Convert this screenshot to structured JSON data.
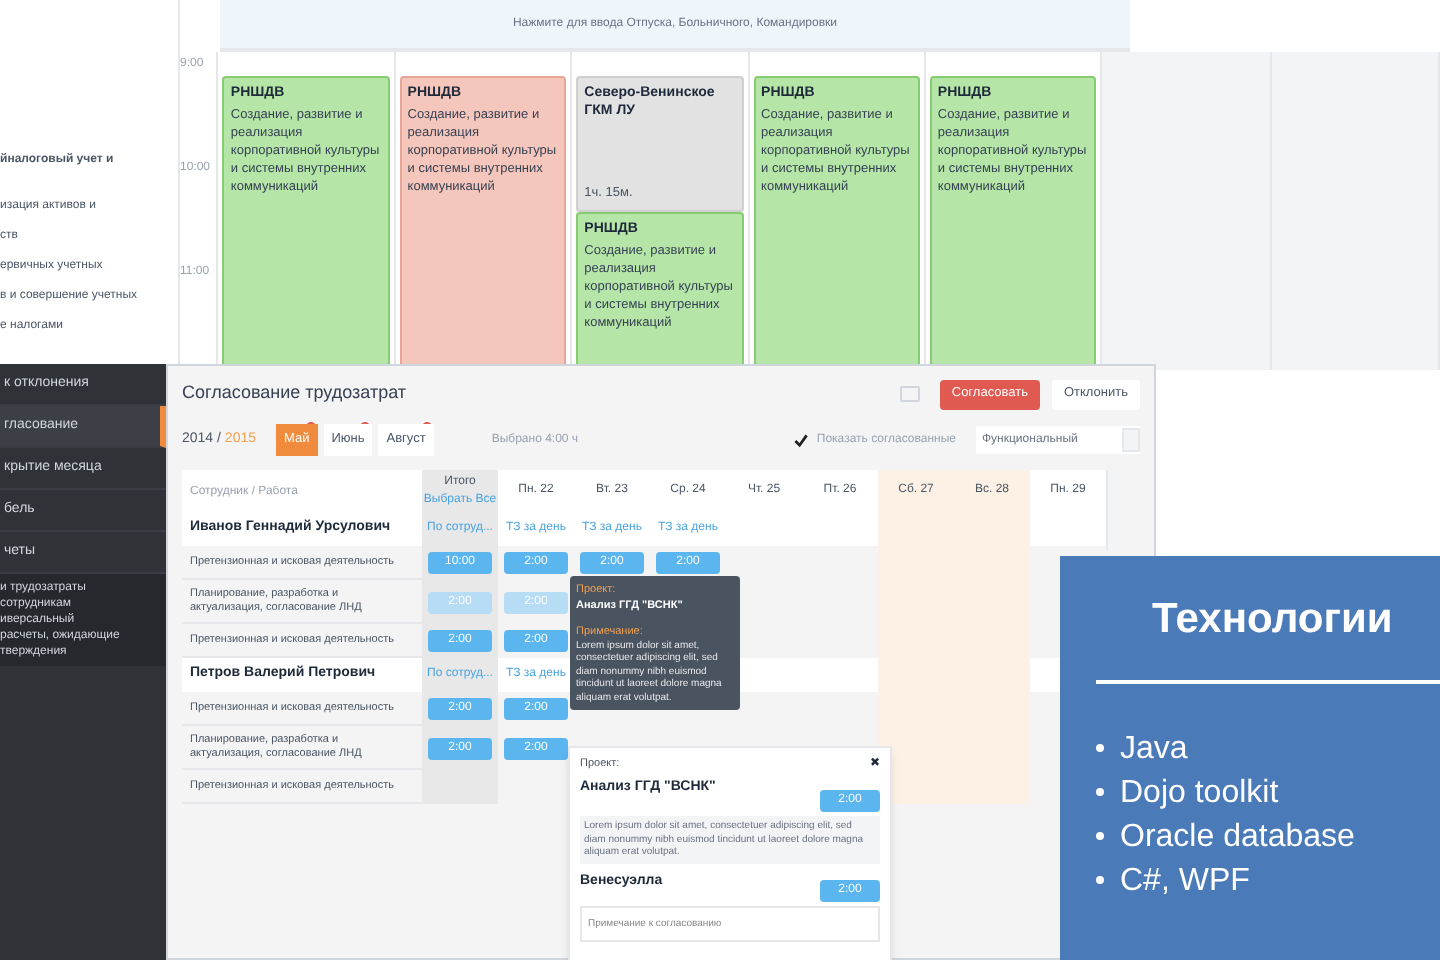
{
  "background_sidebar": {
    "items": [
      "йналоговый учет и",
      "изация активов и",
      "ств",
      "ервичных учетных",
      "в и совершение учетных",
      "е налогами"
    ]
  },
  "calendar": {
    "banner": "Нажмите для ввода Отпуска, Больничного, Командировки",
    "times": [
      "9:00",
      "10:00",
      "11:00"
    ],
    "columns": [
      {
        "events": [
          {
            "title": "РНШДВ",
            "text": "Создание, развитие и реализация корпоративной культуры и системы внутренних коммуникаций",
            "color": "#b5e6a8"
          }
        ]
      },
      {
        "events": [
          {
            "title": "РНШДВ",
            "text": "Создание, развитие и реализация корпоративной культуры и системы внутренних коммуникаций",
            "color": "#f5c6bb"
          }
        ]
      },
      {
        "events": [
          {
            "title": "Северо-Венинское ГКМ ЛУ",
            "duration": "1ч. 15м.",
            "color": "#e2e2e2"
          },
          {
            "title": "РНШДВ",
            "text": "Создание, развитие и реализация корпоративной культуры и системы внутренних коммуникаций",
            "color": "#b5e6a8"
          }
        ]
      },
      {
        "events": [
          {
            "title": "РНШДВ",
            "text": "Создание, развитие и реализация корпоративной культуры и системы внутренних коммуникаций",
            "color": "#b5e6a8"
          }
        ]
      },
      {
        "events": [
          {
            "title": "РНШДВ",
            "text": "Создание, развитие и реализация корпоративной культуры и системы внутренних коммуникаций",
            "color": "#b5e6a8"
          }
        ]
      }
    ]
  },
  "nav": {
    "items": [
      {
        "label": "к отклонения",
        "selected": false
      },
      {
        "label": "гласование",
        "selected": true
      },
      {
        "label": "крытие месяца",
        "selected": false
      },
      {
        "label": "бель",
        "selected": false
      },
      {
        "label": "четы",
        "selected": false
      }
    ],
    "subitems": [
      "и трудозатраты",
      "сотрудникам",
      "иверсальный",
      "расчеты, ожидающие",
      "тверждения"
    ]
  },
  "approval": {
    "title": "Согласование трудозатрат",
    "buttons": [
      {
        "label": "Согласовать",
        "kind": "primary"
      },
      {
        "label": "Отклонить",
        "kind": "plain"
      }
    ],
    "year": "2014",
    "year_separator": "/",
    "next_year": "2015",
    "months": [
      {
        "label": "Май",
        "selected": true
      },
      {
        "label": "Июнь",
        "selected": false
      },
      {
        "label": "Август",
        "selected": false
      }
    ],
    "selected_total": "Выбрано 4:00 ч",
    "show_approved": {
      "label": "Показать согласованные",
      "checked": true
    },
    "view_select": {
      "value": "Функциональный"
    },
    "table": {
      "employee_filter": {
        "placeholder": "Сотрудник / Работа"
      },
      "total_title": "Итого",
      "select_all": "Выбрать Все",
      "days": [
        {
          "label": "Пн. 22",
          "weekend": false
        },
        {
          "label": "Вт. 23",
          "weekend": false
        },
        {
          "label": "Ср. 24",
          "weekend": false
        },
        {
          "label": "Чт. 25",
          "weekend": false
        },
        {
          "label": "Пт. 26",
          "weekend": false
        },
        {
          "label": "Сб. 27",
          "weekend": true
        },
        {
          "label": "Вс. 28",
          "weekend": true
        },
        {
          "label": "Пн. 29",
          "weekend": false
        }
      ],
      "rows": [
        {
          "kind": "employee",
          "name": "Иванов Геннадий Урсулович",
          "total_link": "По сотруд...",
          "day_links": [
            "ТЗ за день",
            "ТЗ за день",
            "ТЗ за день"
          ]
        },
        {
          "kind": "work",
          "name": "Претензионная и исковая деятельность",
          "faded": false,
          "total": "10:00",
          "days": [
            "2:00",
            "2:00",
            "2:00"
          ]
        },
        {
          "kind": "work",
          "name": "Планирование, разработка и актуализация, согласование ЛНД",
          "faded": true,
          "total": "2:00",
          "days": [
            "2:00"
          ]
        },
        {
          "kind": "work",
          "name": "Претензионная и исковая деятельность",
          "faded": false,
          "total": "2:00",
          "days": [
            "2:00"
          ]
        },
        {
          "kind": "employee",
          "name": "Петров Валерий Петрович",
          "total_link": "По сотруд...",
          "day_links": [
            "ТЗ за день"
          ]
        },
        {
          "kind": "work",
          "name": "Претензионная и исковая деятельность",
          "faded": false,
          "total": "2:00",
          "days": [
            "2:00"
          ]
        },
        {
          "kind": "work",
          "name": "Планирование, разработка и актуализация, согласование ЛНД",
          "faded": false,
          "total": "2:00",
          "days": [
            "2:00"
          ]
        },
        {
          "kind": "work",
          "name": "Претензионная и исковая деятельность"
        }
      ]
    }
  },
  "tooltip": {
    "project_label": "Проект:",
    "project": "Анализ ГГД \"ВСНК\"",
    "note_label": "Примечание:",
    "note": "Lorem ipsum dolor sit amet, consectetuer adipiscing elit, sed diam nonummy nibh euismod tincidunt ut laoreet dolore magna aliquam erat volutpat."
  },
  "popup": {
    "project_label": "Проект:",
    "close": "✖",
    "project": "Анализ ГГД \"ВСНК\"",
    "hours": "2:00",
    "note": "Lorem ipsum dolor sit amet, consectetuer adipiscing elit, sed diam nonummy nibh euismod tincidunt ut laoreet dolore magna aliquam erat volutpat.",
    "place": "Венесуэлла",
    "place_hours": "2:00",
    "comment_placeholder": "Примечание к согласованию"
  },
  "slide": {
    "title": "Технологии",
    "bullets": [
      "Java",
      "Dojo toolkit",
      "Oracle database",
      "C#, WPF"
    ]
  }
}
